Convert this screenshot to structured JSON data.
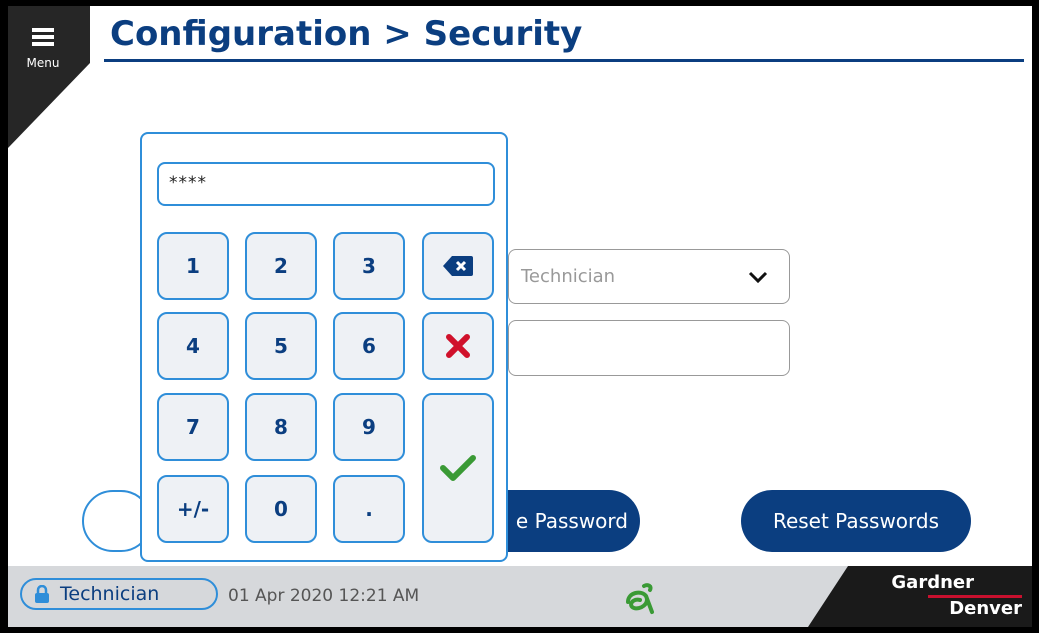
{
  "header": {
    "menu_label": "Menu",
    "title": "Configuration > Security"
  },
  "form": {
    "user_level_value": "Technician",
    "password_value": ""
  },
  "buttons": {
    "change_password_label": "Change Password",
    "change_password_visible": "e Password",
    "reset_passwords_label": "Reset Passwords"
  },
  "keypad": {
    "display_value": "****",
    "keys": [
      "1",
      "2",
      "3",
      "4",
      "5",
      "6",
      "7",
      "8",
      "9",
      "+/-",
      "0",
      "."
    ],
    "icons": [
      "backspace-icon",
      "cancel-icon",
      "confirm-icon"
    ]
  },
  "status_bar": {
    "user": "Technician",
    "datetime": "01 Apr 2020 12:21 AM",
    "brand_line1": "Gardner",
    "brand_line2": "Denver"
  },
  "colors": {
    "primary": "#0b3e80",
    "accent": "#2f8ed9",
    "cancel": "#d0112b",
    "confirm": "#3a9a35",
    "status_bar": "#d6d8db"
  }
}
